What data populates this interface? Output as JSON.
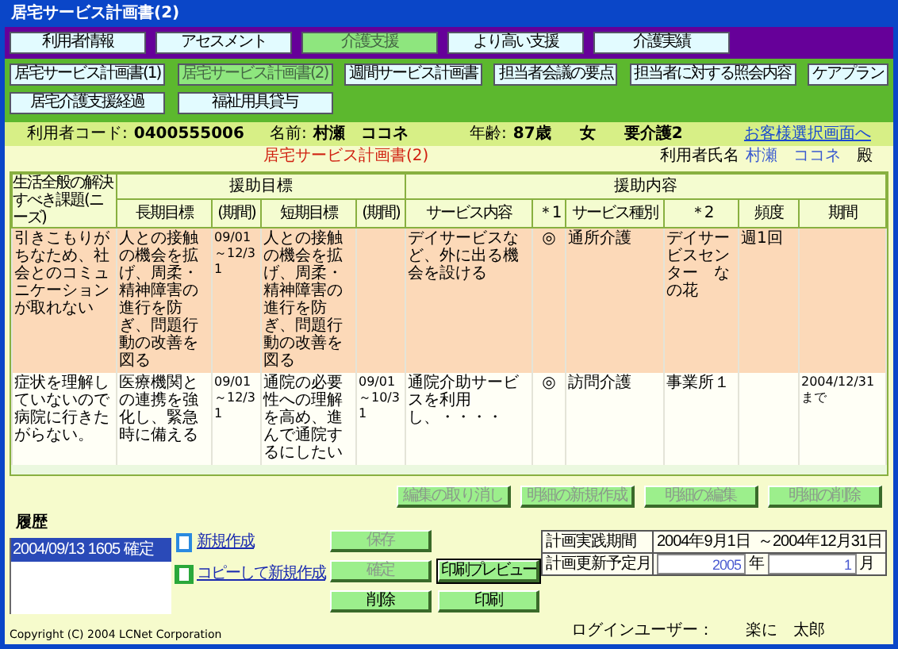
{
  "window": {
    "title": "居宅サービス計画書(2)"
  },
  "top_tabs": [
    {
      "label": "利用者情報",
      "selected": false
    },
    {
      "label": "アセスメント",
      "selected": false
    },
    {
      "label": "介護支援",
      "selected": true
    },
    {
      "label": "より高い支援",
      "selected": false
    },
    {
      "label": "介護実績",
      "selected": false
    }
  ],
  "sub_tabs": [
    {
      "label": "居宅サービス計画書(1)",
      "selected": false
    },
    {
      "label": "居宅サービス計画書(2)",
      "selected": true
    },
    {
      "label": "週間サービス計画書",
      "selected": false
    },
    {
      "label": "担当者会議の要点",
      "selected": false
    },
    {
      "label": "担当者に対する照会内容",
      "selected": false
    },
    {
      "label": "ケアプラン",
      "selected": false
    },
    {
      "label": "居宅介護支援経過",
      "selected": false
    },
    {
      "label": "福祉用具貸与",
      "selected": false
    }
  ],
  "client_bar": {
    "code_label": "利用者コード:",
    "code": "0400555006",
    "name_label": "名前:",
    "name": "村瀬　ココネ",
    "age_label": "年齢:",
    "age": "87歳",
    "sex": "女",
    "care_level": "要介護2",
    "link": "お客様選択画面へ"
  },
  "form": {
    "title": "居宅サービス計画書(2)",
    "user_label": "利用者氏名",
    "user_name": "村瀬　ココネ",
    "honorific": "殿"
  },
  "table": {
    "needs_header": "生活全般の解決すべき課題(ニーズ)",
    "group_1": "援助目標",
    "group_2": "援助内容",
    "columns": [
      "長期目標",
      "(期間)",
      "短期目標",
      "(期間)",
      "サービス内容",
      "＊1",
      "サービス種別",
      "＊2",
      "頻度",
      "期間"
    ],
    "rows": [
      {
        "selected": true,
        "needs": "引きこもりがちなため、社会とのコミュニケーションが取れない",
        "long_goal": "人との接触の機会を拡げ、周柔・精神障害の進行を防ぎ、問題行動の改善を図る",
        "long_period": "09/01～12/31",
        "short_goal": "人との接触の機会を拡げ、周柔・精神障害の進行を防ぎ、問題行動の改善を図る",
        "service": "デイサービスなど、外に出る機会を設ける",
        "mark_1": "◎",
        "service_type": "通所介護",
        "mark_2": "デイサービスセンター　なの花",
        "frequency": "週1回"
      },
      {
        "selected": false,
        "needs": "症状を理解していないので病院に行きたがらない。",
        "long_goal": "医療機関との連携を強化し、緊急時に備える",
        "long_period": "09/01～12/31",
        "short_goal": "通院の必要性への理解を高め、進んで通院するにしたい",
        "short_period": "09/01～10/31",
        "service": "通院介助サービスを利用し、・・・・",
        "mark_1": "◎",
        "service_type": "訪問介護",
        "mark_2": "事業所１",
        "period": "2004/12/31まで"
      }
    ]
  },
  "detail_buttons": [
    {
      "label": "編集の取り消し",
      "disabled": true
    },
    {
      "label": "明細の新規作成",
      "disabled": true
    },
    {
      "label": "明細の編集",
      "disabled": true
    },
    {
      "label": "明細の削除",
      "disabled": true
    }
  ],
  "history": {
    "label": "履歴",
    "items": [
      {
        "text": "2004/09/13 1605 確定",
        "selected": true
      }
    ]
  },
  "links": [
    {
      "label": "新規作成"
    },
    {
      "label": "コピーして新規作成"
    }
  ],
  "actions": {
    "save": {
      "label": "保存",
      "disabled": true
    },
    "confirm": {
      "label": "確定",
      "disabled": true
    },
    "delete": {
      "label": "削除",
      "disabled": false
    },
    "preview": {
      "label": "印刷プレビュー",
      "disabled": false
    },
    "print": {
      "label": "印刷",
      "disabled": false
    }
  },
  "plan": {
    "period_label": "計画実践期間",
    "start": "2004年9月1日",
    "end": "～2004年12月31日",
    "update_label": "計画更新予定月",
    "year": "2005",
    "year_unit": "年",
    "month": "1",
    "month_unit": "月"
  },
  "footer": {
    "copyright": "Copyright (C) 2004 LCNet Corporation",
    "login_label": "ログインユーザー：",
    "login_user": "楽に　太郎"
  }
}
